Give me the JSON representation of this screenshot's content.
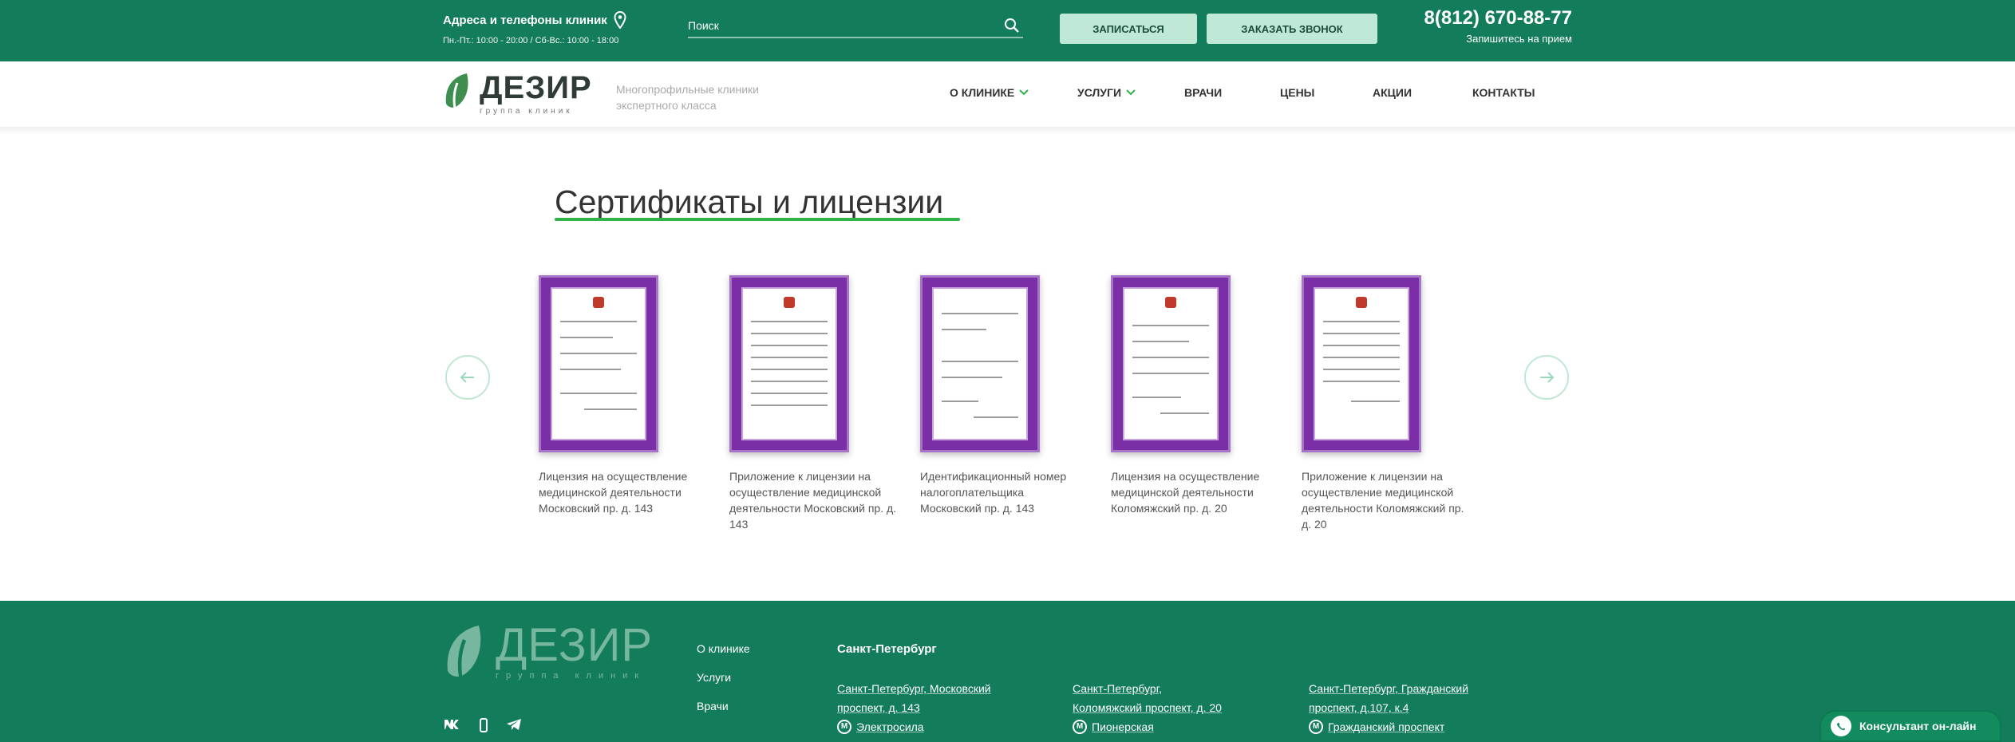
{
  "topbar": {
    "address_title": "Адреса и телефоны клиник",
    "hours": "Пн.-Пт.: 10:00 - 20:00 / Сб-Вс.: 10:00 - 18:00",
    "search_placeholder": "Поиск",
    "signup_label": "Записаться",
    "callback_label": "Заказать звонок",
    "phone": "8(812) 670-88-77",
    "phone_sub": "Запишитесь на прием"
  },
  "header": {
    "logo_name": "ДЕЗИР",
    "logo_sub": "группа клиник",
    "tagline_1": "Многопрофильные клиники",
    "tagline_2": "экспертного класса"
  },
  "nav": {
    "items": [
      {
        "label": "О клинике",
        "has_dropdown": true
      },
      {
        "label": "Услуги",
        "has_dropdown": true
      },
      {
        "label": "Врачи",
        "has_dropdown": false
      },
      {
        "label": "Цены",
        "has_dropdown": false
      },
      {
        "label": "Акции",
        "has_dropdown": false
      },
      {
        "label": "Контакты",
        "has_dropdown": false
      }
    ]
  },
  "section": {
    "title": "Сертификаты и лицензии",
    "cards": [
      {
        "caption": "Лицензия на осуществление медицинской деятельности Московский пр. д. 143"
      },
      {
        "caption": "Приложение к лицензии на осуществление медицинской деятельности Московский пр. д. 143"
      },
      {
        "caption": "Идентификационный номер налогоплательщика Московский пр. д. 143"
      },
      {
        "caption": "Лицензия на осуществление медицинской деятельности Коломяжский пр. д. 20"
      },
      {
        "caption": "Приложение к лицензии на осуществление медицинской деятельности Коломяжский пр. д. 20"
      }
    ]
  },
  "footer": {
    "logo_name": "ДЕЗИР",
    "logo_sub": "группа клиник",
    "menu": [
      "О клинике",
      "Услуги",
      "Врачи"
    ],
    "city": "Санкт-Петербург",
    "addresses": [
      {
        "line1": "Санкт-Петербург, Московский",
        "line2": "проспект, д. 143",
        "metro": "Электросила"
      },
      {
        "line1": "Санкт-Петербург,",
        "line2": "Коломяжский проспект, д. 20",
        "metro": "Пионерская"
      },
      {
        "line1": "Санкт-Петербург, Гражданский",
        "line2": "проспект, д.107, к.4",
        "metro": "Гражданский проспект"
      }
    ],
    "chat_label": "Консультант он-лайн"
  },
  "colors": {
    "brand_green": "#137c5a",
    "accent_green": "#2fb34a",
    "button_bg": "#bfe9d6",
    "certificate_purple": "#7b2fa6"
  },
  "icons": [
    "location-pin-icon",
    "search-icon",
    "leaf-logo-icon",
    "chevron-down-icon",
    "arrow-left-icon",
    "arrow-right-icon",
    "vk-icon",
    "phone-icon",
    "telegram-icon",
    "metro-icon",
    "whatsapp-icon"
  ]
}
